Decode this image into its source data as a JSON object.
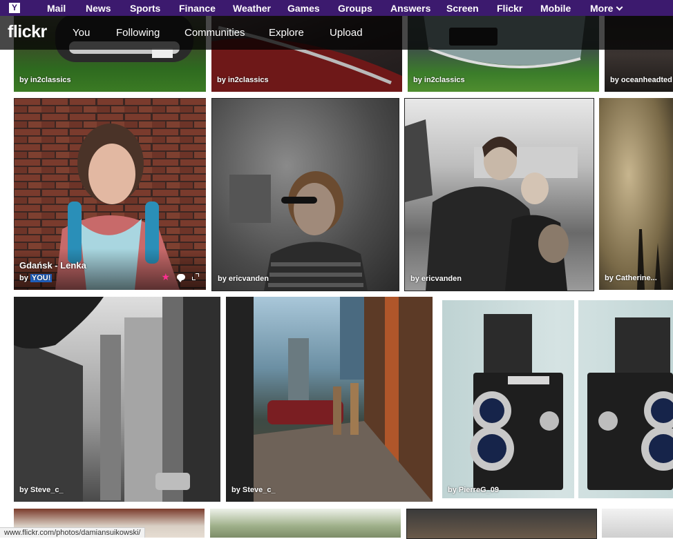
{
  "yahoo_bar": {
    "logo": "Y",
    "links": [
      "Mail",
      "News",
      "Sports",
      "Finance",
      "Weather",
      "Games",
      "Groups",
      "Answers",
      "Screen",
      "Flickr",
      "Mobile"
    ],
    "more": "More"
  },
  "flickr_nav": {
    "logo": "flickr",
    "items": [
      "You",
      "Following",
      "Communities",
      "Explore",
      "Upload"
    ]
  },
  "photos": {
    "row1": [
      {
        "caption": "by in2classics"
      },
      {
        "caption": "by in2classics"
      },
      {
        "caption": "by in2classics"
      },
      {
        "caption": "by oceanheadted"
      }
    ],
    "row2": [
      {
        "title": "Gdańsk - Lenka",
        "by": "by",
        "owner": "YOU!"
      },
      {
        "caption": "by ericvanden"
      },
      {
        "caption": "by ericvanden"
      },
      {
        "caption": "by Catherine..."
      }
    ],
    "row3": [
      {
        "caption": "by Steve_c_"
      },
      {
        "caption": "by Steve_c_"
      },
      {
        "caption": "by PierreG_09"
      }
    ]
  },
  "status_url": "www.flickr.com/photos/damiansuikowski/",
  "colors": {
    "yahoo_purple": "#3c1a6e",
    "favorite_pink": "#ff2f92",
    "you_highlight": "#1f5fbd"
  }
}
